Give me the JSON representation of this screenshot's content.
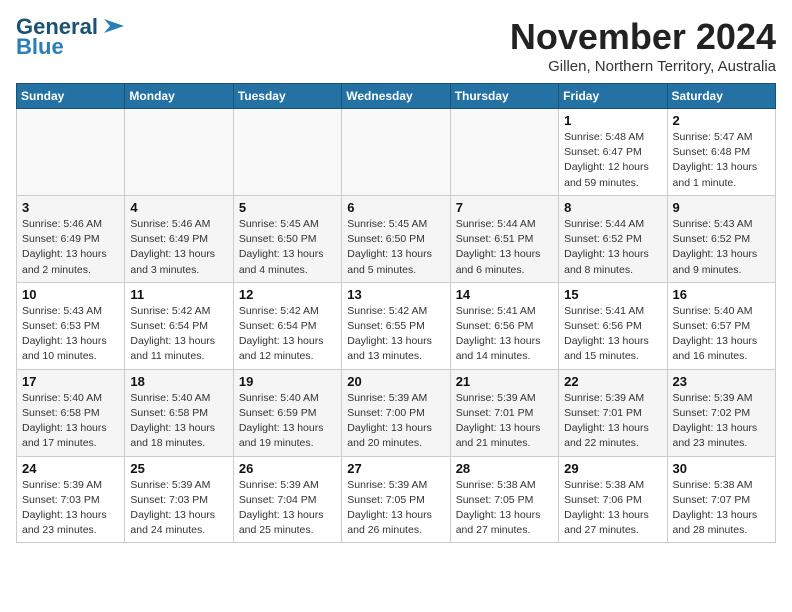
{
  "logo": {
    "general": "General",
    "blue": "Blue"
  },
  "title": "November 2024",
  "subtitle": "Gillen, Northern Territory, Australia",
  "headers": [
    "Sunday",
    "Monday",
    "Tuesday",
    "Wednesday",
    "Thursday",
    "Friday",
    "Saturday"
  ],
  "weeks": [
    [
      {
        "day": "",
        "info": ""
      },
      {
        "day": "",
        "info": ""
      },
      {
        "day": "",
        "info": ""
      },
      {
        "day": "",
        "info": ""
      },
      {
        "day": "",
        "info": ""
      },
      {
        "day": "1",
        "info": "Sunrise: 5:48 AM\nSunset: 6:47 PM\nDaylight: 12 hours\nand 59 minutes."
      },
      {
        "day": "2",
        "info": "Sunrise: 5:47 AM\nSunset: 6:48 PM\nDaylight: 13 hours\nand 1 minute."
      }
    ],
    [
      {
        "day": "3",
        "info": "Sunrise: 5:46 AM\nSunset: 6:49 PM\nDaylight: 13 hours\nand 2 minutes."
      },
      {
        "day": "4",
        "info": "Sunrise: 5:46 AM\nSunset: 6:49 PM\nDaylight: 13 hours\nand 3 minutes."
      },
      {
        "day": "5",
        "info": "Sunrise: 5:45 AM\nSunset: 6:50 PM\nDaylight: 13 hours\nand 4 minutes."
      },
      {
        "day": "6",
        "info": "Sunrise: 5:45 AM\nSunset: 6:50 PM\nDaylight: 13 hours\nand 5 minutes."
      },
      {
        "day": "7",
        "info": "Sunrise: 5:44 AM\nSunset: 6:51 PM\nDaylight: 13 hours\nand 6 minutes."
      },
      {
        "day": "8",
        "info": "Sunrise: 5:44 AM\nSunset: 6:52 PM\nDaylight: 13 hours\nand 8 minutes."
      },
      {
        "day": "9",
        "info": "Sunrise: 5:43 AM\nSunset: 6:52 PM\nDaylight: 13 hours\nand 9 minutes."
      }
    ],
    [
      {
        "day": "10",
        "info": "Sunrise: 5:43 AM\nSunset: 6:53 PM\nDaylight: 13 hours\nand 10 minutes."
      },
      {
        "day": "11",
        "info": "Sunrise: 5:42 AM\nSunset: 6:54 PM\nDaylight: 13 hours\nand 11 minutes."
      },
      {
        "day": "12",
        "info": "Sunrise: 5:42 AM\nSunset: 6:54 PM\nDaylight: 13 hours\nand 12 minutes."
      },
      {
        "day": "13",
        "info": "Sunrise: 5:42 AM\nSunset: 6:55 PM\nDaylight: 13 hours\nand 13 minutes."
      },
      {
        "day": "14",
        "info": "Sunrise: 5:41 AM\nSunset: 6:56 PM\nDaylight: 13 hours\nand 14 minutes."
      },
      {
        "day": "15",
        "info": "Sunrise: 5:41 AM\nSunset: 6:56 PM\nDaylight: 13 hours\nand 15 minutes."
      },
      {
        "day": "16",
        "info": "Sunrise: 5:40 AM\nSunset: 6:57 PM\nDaylight: 13 hours\nand 16 minutes."
      }
    ],
    [
      {
        "day": "17",
        "info": "Sunrise: 5:40 AM\nSunset: 6:58 PM\nDaylight: 13 hours\nand 17 minutes."
      },
      {
        "day": "18",
        "info": "Sunrise: 5:40 AM\nSunset: 6:58 PM\nDaylight: 13 hours\nand 18 minutes."
      },
      {
        "day": "19",
        "info": "Sunrise: 5:40 AM\nSunset: 6:59 PM\nDaylight: 13 hours\nand 19 minutes."
      },
      {
        "day": "20",
        "info": "Sunrise: 5:39 AM\nSunset: 7:00 PM\nDaylight: 13 hours\nand 20 minutes."
      },
      {
        "day": "21",
        "info": "Sunrise: 5:39 AM\nSunset: 7:01 PM\nDaylight: 13 hours\nand 21 minutes."
      },
      {
        "day": "22",
        "info": "Sunrise: 5:39 AM\nSunset: 7:01 PM\nDaylight: 13 hours\nand 22 minutes."
      },
      {
        "day": "23",
        "info": "Sunrise: 5:39 AM\nSunset: 7:02 PM\nDaylight: 13 hours\nand 23 minutes."
      }
    ],
    [
      {
        "day": "24",
        "info": "Sunrise: 5:39 AM\nSunset: 7:03 PM\nDaylight: 13 hours\nand 23 minutes."
      },
      {
        "day": "25",
        "info": "Sunrise: 5:39 AM\nSunset: 7:03 PM\nDaylight: 13 hours\nand 24 minutes."
      },
      {
        "day": "26",
        "info": "Sunrise: 5:39 AM\nSunset: 7:04 PM\nDaylight: 13 hours\nand 25 minutes."
      },
      {
        "day": "27",
        "info": "Sunrise: 5:39 AM\nSunset: 7:05 PM\nDaylight: 13 hours\nand 26 minutes."
      },
      {
        "day": "28",
        "info": "Sunrise: 5:38 AM\nSunset: 7:05 PM\nDaylight: 13 hours\nand 27 minutes."
      },
      {
        "day": "29",
        "info": "Sunrise: 5:38 AM\nSunset: 7:06 PM\nDaylight: 13 hours\nand 27 minutes."
      },
      {
        "day": "30",
        "info": "Sunrise: 5:38 AM\nSunset: 7:07 PM\nDaylight: 13 hours\nand 28 minutes."
      }
    ]
  ]
}
